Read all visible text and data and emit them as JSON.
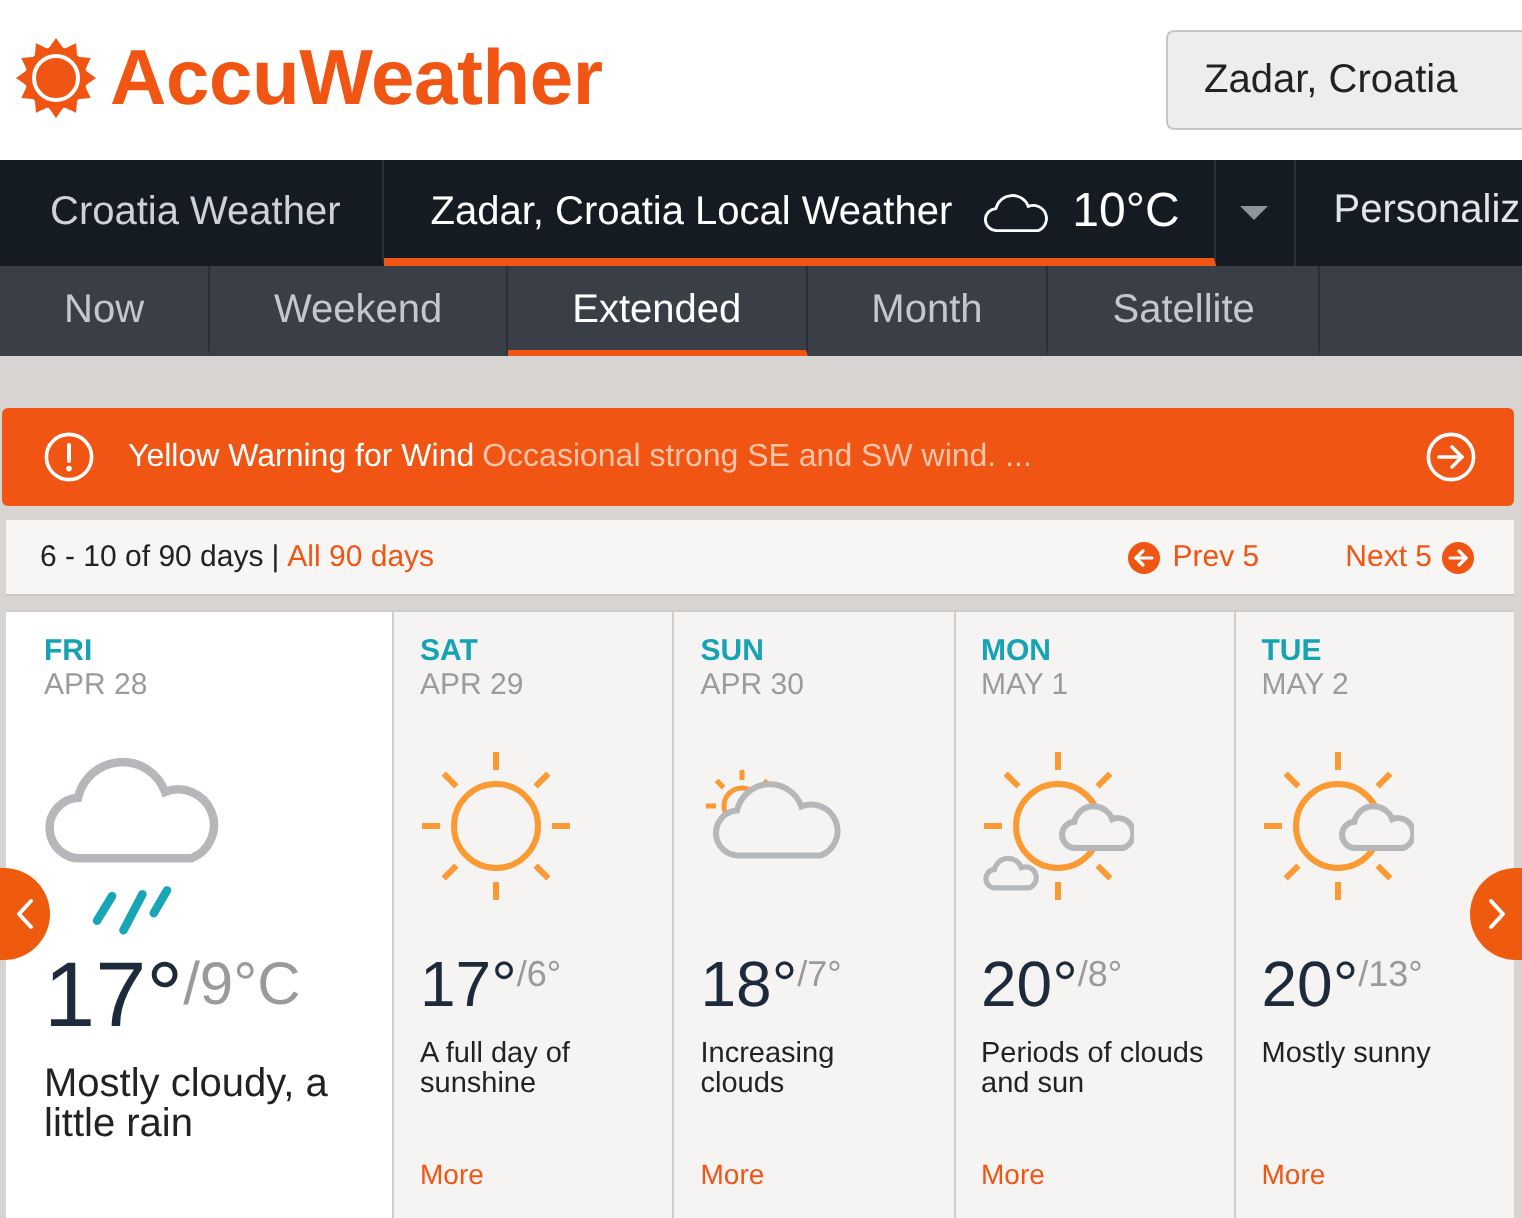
{
  "header": {
    "logo": "AccuWeather",
    "search": {
      "value": "Zadar, Croatia"
    }
  },
  "nav": {
    "items": [
      {
        "label": "Croatia Weather",
        "selected": false
      },
      {
        "label": "Zadar, Croatia Local Weather",
        "temp": "10°C",
        "selected": true
      }
    ],
    "personalize": "Personaliz"
  },
  "subnav": [
    {
      "label": "Now",
      "selected": false
    },
    {
      "label": "Weekend",
      "selected": false
    },
    {
      "label": "Extended",
      "selected": true
    },
    {
      "label": "Month",
      "selected": false
    },
    {
      "label": "Satellite",
      "selected": false
    }
  ],
  "alert": {
    "title": "Yellow Warning for Wind",
    "message": "Occasional strong SE and SW wind. ..."
  },
  "pager": {
    "range": "6 - 10 of 90 days",
    "separator": "|",
    "all": "All 90 days",
    "prev": "Prev 5",
    "next": "Next 5"
  },
  "days": [
    {
      "day": "FRI",
      "date": "APR 28",
      "kind": "rain",
      "high": "17°",
      "low": "/9°C",
      "phrase": "Mostly cloudy, a little rain",
      "selected": true
    },
    {
      "day": "SAT",
      "date": "APR 29",
      "kind": "sunny",
      "high": "17°",
      "low": "/6°",
      "phrase": "A full day of sunshine",
      "more": "More",
      "selected": false
    },
    {
      "day": "SUN",
      "date": "APR 30",
      "kind": "clouding",
      "high": "18°",
      "low": "/7°",
      "phrase": "Increasing clouds",
      "more": "More",
      "selected": false
    },
    {
      "day": "MON",
      "date": "MAY 1",
      "kind": "partly",
      "high": "20°",
      "low": "/8°",
      "phrase": "Periods of clouds and sun",
      "more": "More",
      "selected": false
    },
    {
      "day": "TUE",
      "date": "MAY 2",
      "kind": "mostlysunny",
      "high": "20°",
      "low": "/13°",
      "phrase": "Mostly sunny",
      "more": "More",
      "selected": false
    }
  ]
}
